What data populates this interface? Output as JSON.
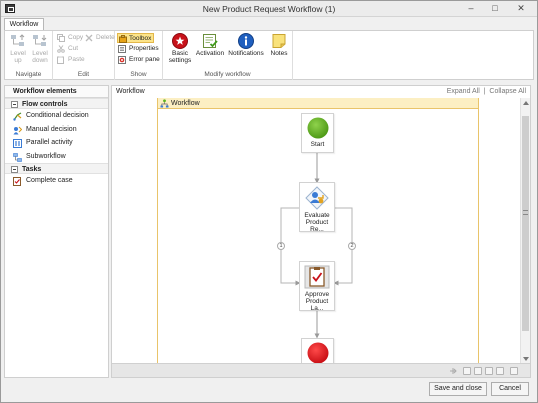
{
  "window": {
    "title": "New Product Request Workflow (1)",
    "minimize_glyph": "–",
    "maximize_glyph": "□",
    "close_glyph": "✕",
    "icon": "app-window-icon"
  },
  "ribbon": {
    "active_tab": "Workflow",
    "groups": {
      "navigate": {
        "label": "Navigate",
        "level_up": "Level up",
        "level_down": "Level down"
      },
      "edit": {
        "label": "Edit",
        "copy": "Copy",
        "delete": "Delete",
        "cut": "Cut",
        "paste": "Paste"
      },
      "show": {
        "label": "Show",
        "toolbox": "Toolbox",
        "properties": "Properties",
        "error_pane": "Error pane"
      },
      "modify": {
        "label": "Modify workflow",
        "basic_settings": "Basic settings",
        "activation": "Activation",
        "notifications": "Notifications",
        "notes": "Notes"
      }
    }
  },
  "toolbox": {
    "title": "Workflow elements",
    "sections": [
      {
        "label": "Flow controls",
        "items": [
          "Conditional decision",
          "Manual decision",
          "Parallel activity",
          "Subworkflow"
        ]
      },
      {
        "label": "Tasks",
        "items": [
          "Complete case"
        ]
      }
    ]
  },
  "canvas": {
    "breadcrumb": "Workflow",
    "expand_all": "Expand All",
    "collapse_all": "Collapse All",
    "workflow_title": "Workflow",
    "nodes": {
      "start": "Start",
      "evaluate": "Evaluate Product Re...",
      "approve": "Approve Product La..."
    },
    "branches": [
      "1",
      "2"
    ]
  },
  "buttons": {
    "save_close": "Save and close",
    "cancel": "Cancel"
  },
  "colors": {
    "start_node": "#5db31f",
    "end_node": "#e1141b",
    "workflow_border": "#e9c46a",
    "workflow_header": "#fcefc3",
    "toolbox_active": "#fce48a"
  }
}
